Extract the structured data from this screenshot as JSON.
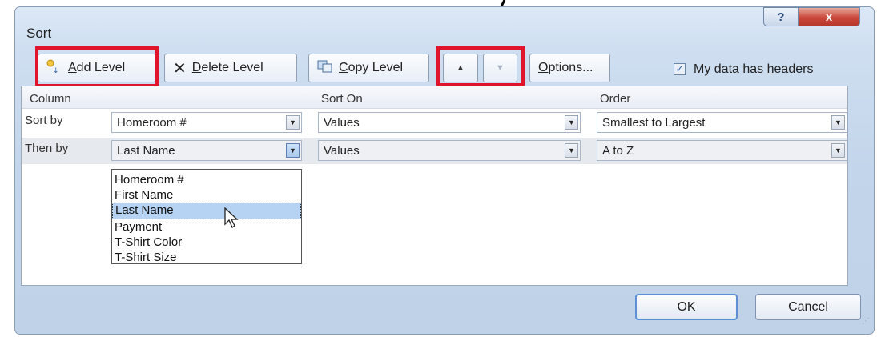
{
  "dialog": {
    "title": "Sort"
  },
  "title_buttons": {
    "help": "?",
    "close": "x"
  },
  "toolbar": {
    "add_level": {
      "prefix": "",
      "u": "A",
      "suffix": "dd Level"
    },
    "delete_level": {
      "prefix": "",
      "u": "D",
      "suffix": "elete Level"
    },
    "copy_level": {
      "prefix": "",
      "u": "C",
      "suffix": "opy Level"
    },
    "move_up_icon": "▲",
    "move_down_icon": "▼",
    "options": {
      "prefix": "",
      "u": "O",
      "suffix": "ptions..."
    },
    "my_data_has_headers": {
      "checked": true,
      "prefix": "My data has ",
      "u": "h",
      "suffix": "eaders"
    }
  },
  "grid": {
    "headers": {
      "column": "Column",
      "sort_on": "Sort On",
      "order": "Order"
    },
    "rows": [
      {
        "label": "Sort by",
        "column": "Homeroom #",
        "sort_on": "Values",
        "order": "Smallest to Largest"
      },
      {
        "label": "Then by",
        "column": "Last Name",
        "sort_on": "Values",
        "order": "A to Z"
      }
    ]
  },
  "dropdown": {
    "options": [
      "Homeroom #",
      "First Name",
      "Last Name",
      "Payment",
      "T-Shirt Color",
      "T-Shirt Size"
    ],
    "selected": "Last Name"
  },
  "footer": {
    "ok": "OK",
    "cancel": "Cancel"
  },
  "colors": {
    "highlight": "#e0142a",
    "selection": "#b7d3f3",
    "close_button": "#c9473a"
  }
}
